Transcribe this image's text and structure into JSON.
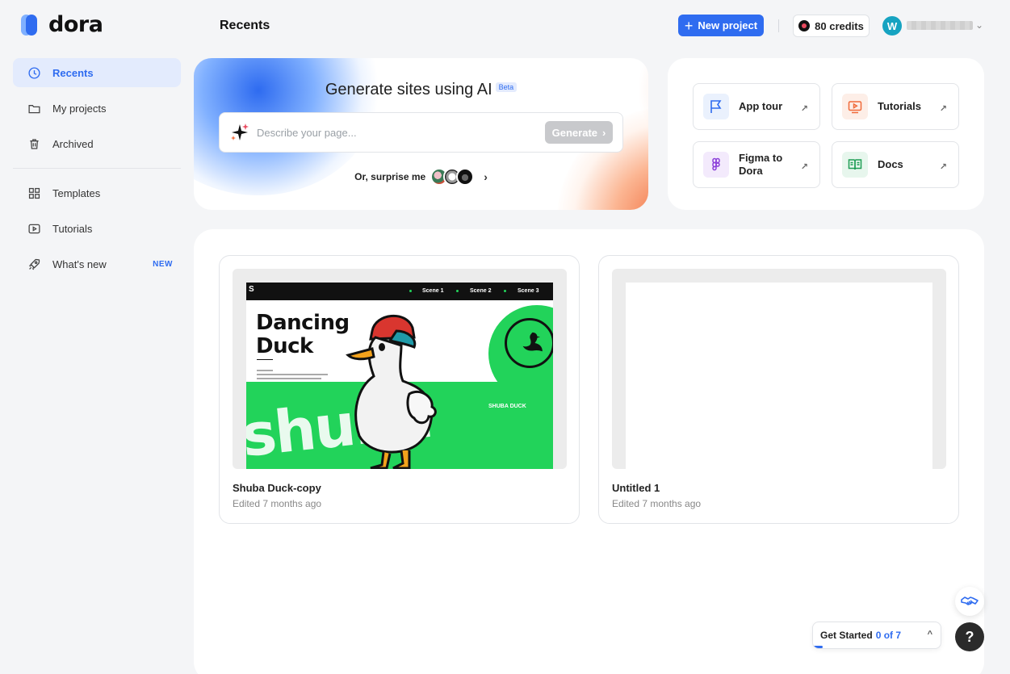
{
  "app": {
    "logo_text": "dora",
    "page_title": "Recents"
  },
  "header": {
    "new_project_label": "New project",
    "credits_label": "80 credits",
    "avatar_initial": "W"
  },
  "sidebar": {
    "items": [
      {
        "label": "Recents",
        "icon": "clock-icon",
        "active": true
      },
      {
        "label": "My projects",
        "icon": "folder-icon"
      },
      {
        "label": "Archived",
        "icon": "trash-icon"
      },
      {
        "label": "Templates",
        "icon": "grid-icon"
      },
      {
        "label": "Tutorials",
        "icon": "play-icon"
      },
      {
        "label": "What's new",
        "icon": "rocket-icon",
        "badge": "NEW"
      }
    ]
  },
  "generate": {
    "title": "Generate sites using AI",
    "beta_label": "Beta",
    "input_placeholder": "Describe your page...",
    "button_label": "Generate",
    "surprise_label": "Or, surprise me"
  },
  "quick_links": [
    {
      "label": "App tour",
      "icon": "flag-icon",
      "color": "#2f6cf0",
      "bg": "#eaf1fd"
    },
    {
      "label": "Tutorials",
      "icon": "video-icon",
      "color": "#f06a3a",
      "bg": "#fdeee7"
    },
    {
      "label": "Figma to Dora",
      "icon": "figma-icon",
      "color": "#8b3fd9",
      "bg": "#f3eafc"
    },
    {
      "label": "Docs",
      "icon": "book-icon",
      "color": "#1f9d55",
      "bg": "#e7f6ed"
    }
  ],
  "projects": [
    {
      "name": "Shuba Duck-copy",
      "edited": "Edited 7 months ago",
      "preview": {
        "nav": [
          "Scene 1",
          "Scene 2",
          "Scene 3"
        ],
        "title_line1": "Dancing",
        "title_line2": "Duck",
        "tagline": "SHUBA DUCK",
        "big_text": "shuba"
      }
    },
    {
      "name": "Untitled 1",
      "edited": "Edited 7 months ago"
    }
  ],
  "onboarding": {
    "label": "Get Started",
    "progress_text": "0 of 7",
    "progress_fraction": 0
  },
  "help_label": "?"
}
